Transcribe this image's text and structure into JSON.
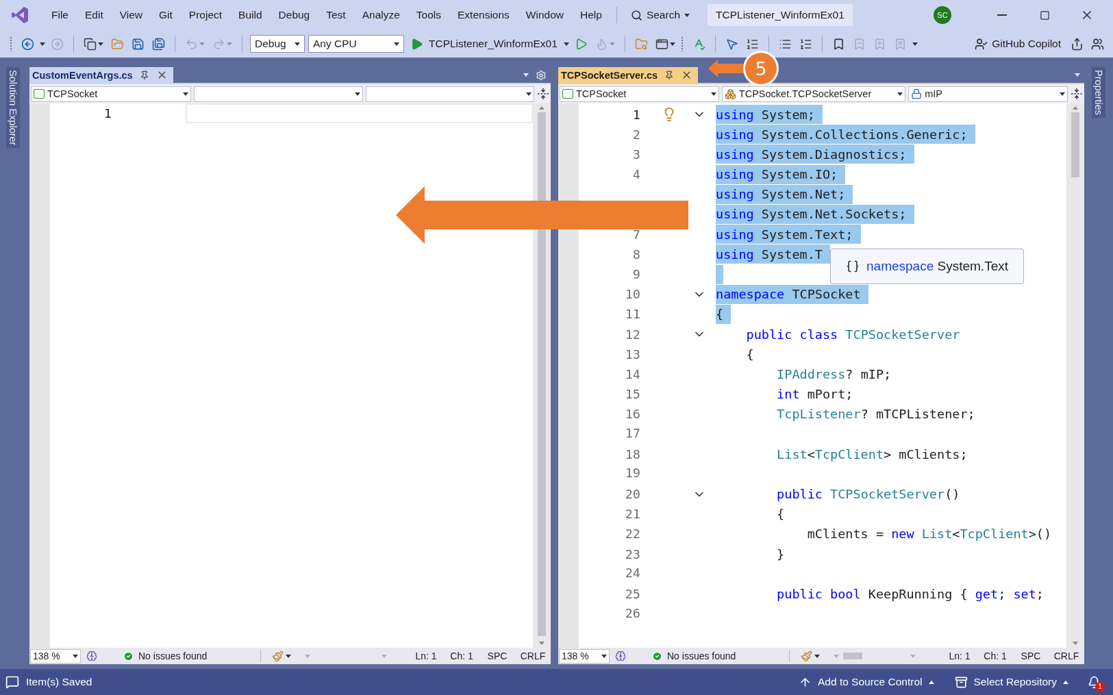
{
  "title_bar": {
    "menus": [
      "File",
      "Edit",
      "View",
      "Git",
      "Project",
      "Build",
      "Debug",
      "Test",
      "Analyze",
      "Tools",
      "Extensions",
      "Window",
      "Help"
    ],
    "search": "Search",
    "solution": "TCPListener_WinformEx01",
    "avatar": "SC"
  },
  "toolbar": {
    "configuration": "Debug",
    "platform": "Any CPU",
    "startup": "TCPListener_WinformEx01",
    "copilot": "GitHub Copilot"
  },
  "side_tabs": {
    "left": "Solution Explorer",
    "right": "Properties"
  },
  "editors": [
    {
      "tab": {
        "title": "CustomEventArgs.cs",
        "selected": false
      },
      "nav": [
        {
          "kind": "project",
          "text": "TCPSocket"
        },
        {
          "kind": "empty"
        },
        {
          "kind": "empty"
        }
      ],
      "lines": [
        {
          "number": "1",
          "current": true,
          "selected": false,
          "fold": false,
          "lightbulb": false
        }
      ],
      "status": {
        "zoom": "138 %",
        "issues": "No issues found",
        "ln": "Ln: 1",
        "ch": "Ch: 1",
        "spacing": "SPC",
        "eol": "CRLF"
      }
    },
    {
      "tab": {
        "title": "TCPSocketServer.cs",
        "selected": true
      },
      "nav": [
        {
          "kind": "project",
          "text": "TCPSocket"
        },
        {
          "kind": "class",
          "text": "TCPSocket.TCPSocketServer"
        },
        {
          "kind": "field",
          "text": "mIP"
        }
      ],
      "lines": [
        {
          "number": "1",
          "current": true,
          "selected": true,
          "fold": true,
          "lightbulb": true,
          "tokens": [
            {
              "kind": "kw",
              "text": "using"
            },
            {
              "kind": "text",
              "text": " System;"
            }
          ]
        },
        {
          "number": "2",
          "current": false,
          "selected": true,
          "fold": false,
          "lightbulb": false,
          "tokens": [
            {
              "kind": "kw",
              "text": "using"
            },
            {
              "kind": "text",
              "text": " System.Collections.Generic;"
            }
          ]
        },
        {
          "number": "3",
          "current": false,
          "selected": true,
          "fold": false,
          "lightbulb": false,
          "tokens": [
            {
              "kind": "kw",
              "text": "using"
            },
            {
              "kind": "text",
              "text": " System.Diagnostics;"
            }
          ]
        },
        {
          "number": "4",
          "current": false,
          "selected": true,
          "fold": false,
          "lightbulb": false,
          "tokens": [
            {
              "kind": "kw",
              "text": "using"
            },
            {
              "kind": "text",
              "text": " System.IO;"
            }
          ]
        },
        {
          "current": false,
          "selected": true,
          "fold": false,
          "lightbulb": false,
          "tokens": [
            {
              "kind": "kw",
              "text": "using"
            },
            {
              "kind": "text",
              "text": " System.Net;"
            }
          ]
        },
        {
          "current": false,
          "selected": true,
          "fold": false,
          "lightbulb": false,
          "tokens": [
            {
              "kind": "kw",
              "text": "using"
            },
            {
              "kind": "text",
              "text": " System.Net.Sockets;"
            }
          ]
        },
        {
          "number": "7",
          "current": false,
          "selected": true,
          "fold": false,
          "lightbulb": false,
          "tokens": [
            {
              "kind": "kw",
              "text": "using"
            },
            {
              "kind": "text",
              "text": " System.Text;"
            }
          ]
        },
        {
          "number": "8",
          "current": false,
          "selected": true,
          "fold": false,
          "lightbulb": false,
          "tokens": [
            {
              "kind": "kw",
              "text": "using"
            },
            {
              "kind": "text",
              "text": " System.T"
            }
          ]
        },
        {
          "number": "9",
          "current": false,
          "selected": true,
          "fold": false,
          "lightbulb": false
        },
        {
          "number": "10",
          "current": false,
          "selected": true,
          "fold": true,
          "lightbulb": false,
          "tokens": [
            {
              "kind": "kw",
              "text": "namespace"
            },
            {
              "kind": "text",
              "text": " TCPSocket"
            }
          ]
        },
        {
          "number": "11",
          "current": false,
          "selected": true,
          "fold": false,
          "lightbulb": false,
          "tokens": [
            {
              "kind": "text",
              "text": "{"
            }
          ]
        },
        {
          "number": "12",
          "current": false,
          "selected": false,
          "fold": true,
          "lightbulb": false,
          "tokens": [
            {
              "kind": "kw",
              "text": "    public class"
            },
            {
              "kind": "type",
              "text": " TCPSocketServer"
            }
          ]
        },
        {
          "number": "13",
          "current": false,
          "selected": false,
          "fold": false,
          "lightbulb": false,
          "tokens": [
            {
              "kind": "text",
              "text": "    {"
            }
          ]
        },
        {
          "number": "14",
          "current": false,
          "selected": false,
          "fold": false,
          "lightbulb": false,
          "tokens": [
            {
              "kind": "type",
              "text": "        IPAddress"
            },
            {
              "kind": "text",
              "text": "? mIP;"
            }
          ]
        },
        {
          "number": "15",
          "current": false,
          "selected": false,
          "fold": false,
          "lightbulb": false,
          "tokens": [
            {
              "kind": "kw",
              "text": "        int"
            },
            {
              "kind": "text",
              "text": " mPort;"
            }
          ]
        },
        {
          "number": "16",
          "current": false,
          "selected": false,
          "fold": false,
          "lightbulb": false,
          "tokens": [
            {
              "kind": "type",
              "text": "        TcpListener"
            },
            {
              "kind": "text",
              "text": "? mTCPListener;"
            }
          ]
        },
        {
          "number": "17",
          "current": false,
          "selected": false,
          "fold": false,
          "lightbulb": false
        },
        {
          "number": "18",
          "current": false,
          "selected": false,
          "fold": false,
          "lightbulb": false,
          "tokens": [
            {
              "kind": "type",
              "text": "        List"
            },
            {
              "kind": "text",
              "text": "<"
            },
            {
              "kind": "type",
              "text": "TcpClient"
            },
            {
              "kind": "text",
              "text": "> mClients;"
            }
          ]
        },
        {
          "number": "19",
          "current": false,
          "selected": false,
          "fold": false,
          "lightbulb": false
        },
        {
          "number": "20",
          "current": false,
          "selected": false,
          "fold": true,
          "lightbulb": false,
          "tokens": [
            {
              "kind": "kw",
              "text": "        public"
            },
            {
              "kind": "type",
              "text": " TCPSocketServer"
            },
            {
              "kind": "text",
              "text": "()"
            }
          ]
        },
        {
          "number": "21",
          "current": false,
          "selected": false,
          "fold": false,
          "lightbulb": false,
          "tokens": [
            {
              "kind": "text",
              "text": "        {"
            }
          ]
        },
        {
          "number": "22",
          "current": false,
          "selected": false,
          "fold": false,
          "lightbulb": false,
          "tokens": [
            {
              "kind": "text",
              "text": "            mClients = "
            },
            {
              "kind": "kw",
              "text": "new"
            },
            {
              "kind": "type",
              "text": " List"
            },
            {
              "kind": "text",
              "text": "<"
            },
            {
              "kind": "type",
              "text": "TcpClient"
            },
            {
              "kind": "text",
              "text": ">()"
            }
          ]
        },
        {
          "number": "23",
          "current": false,
          "selected": false,
          "fold": false,
          "lightbulb": false,
          "tokens": [
            {
              "kind": "text",
              "text": "        }"
            }
          ]
        },
        {
          "number": "24",
          "current": false,
          "selected": false,
          "fold": false,
          "lightbulb": false
        },
        {
          "number": "25",
          "current": false,
          "selected": false,
          "fold": false,
          "lightbulb": false,
          "tokens": [
            {
              "kind": "kw",
              "text": "        public bool"
            },
            {
              "kind": "text",
              "text": " KeepRunning { "
            },
            {
              "kind": "kw",
              "text": "get"
            },
            {
              "kind": "text",
              "text": "; "
            },
            {
              "kind": "kw",
              "text": "set"
            },
            {
              "kind": "text",
              "text": ";"
            }
          ]
        },
        {
          "number": "26",
          "current": false,
          "selected": false,
          "fold": false,
          "lightbulb": false
        }
      ],
      "tooltip": {
        "keyword": "namespace",
        "name": "System.Text"
      },
      "status": {
        "zoom": "138 %",
        "issues": "No issues found",
        "ln": "Ln: 1",
        "ch": "Ch: 1",
        "spacing": "SPC",
        "eol": "CRLF"
      }
    }
  ],
  "annotation": {
    "number": "5"
  },
  "status_bar": {
    "message": "Item(s) Saved",
    "source_control": "Add to Source Control",
    "repository": "Select Repository",
    "notifications": "1"
  }
}
